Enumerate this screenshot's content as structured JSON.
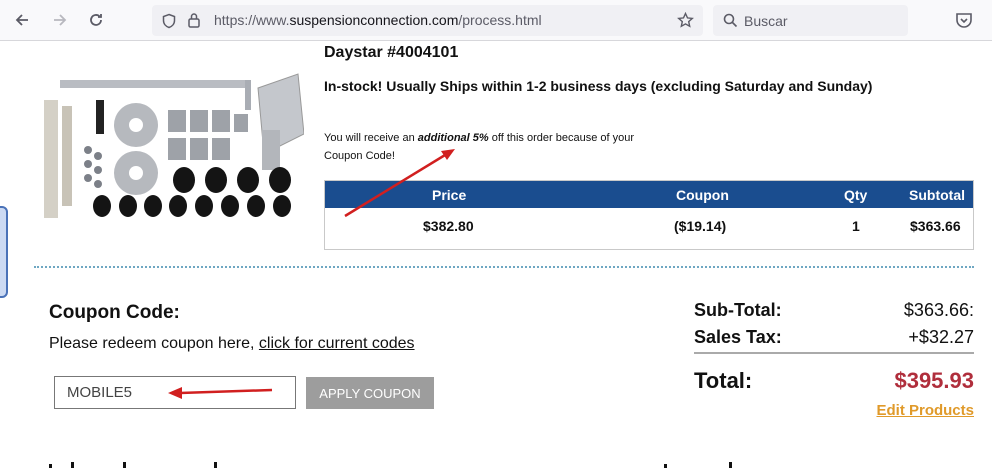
{
  "browser": {
    "url_prefix": "https://www.",
    "url_domain": "suspensionconnection.com",
    "url_path": "/process.html",
    "search_placeholder": "Buscar"
  },
  "product": {
    "title": "Daystar #4004101",
    "stock": "In-stock! Usually Ships within 1-2 business days (excluding Saturday and Sunday)",
    "note_pre": "You will receive an ",
    "note_emph": "additional 5%",
    "note_post": " off this order because of your Coupon Code!"
  },
  "price_table": {
    "headers": [
      "Price",
      "Coupon",
      "Qty",
      "Subtotal"
    ],
    "row": [
      "$382.80",
      "($19.14)",
      "1",
      "$363.66"
    ]
  },
  "coupon": {
    "label": "Coupon Code:",
    "redeem_text": "Please redeem coupon here, ",
    "redeem_link": "click for current codes",
    "input_value": "MOBILE5",
    "apply_label": "APPLY COUPON"
  },
  "summary": {
    "subtotal_label": "Sub-Total:",
    "subtotal_value": "$363.66:",
    "tax_label": "Sales Tax:",
    "tax_value": "+$32.27",
    "total_label": "Total:",
    "total_value": "$395.93",
    "edit_link": "Edit Products"
  },
  "colors": {
    "table_header": "#1a4d8f",
    "total": "#b02e3c",
    "edit_link": "#e09a2a",
    "annotation_arrow": "#d11f1f"
  }
}
